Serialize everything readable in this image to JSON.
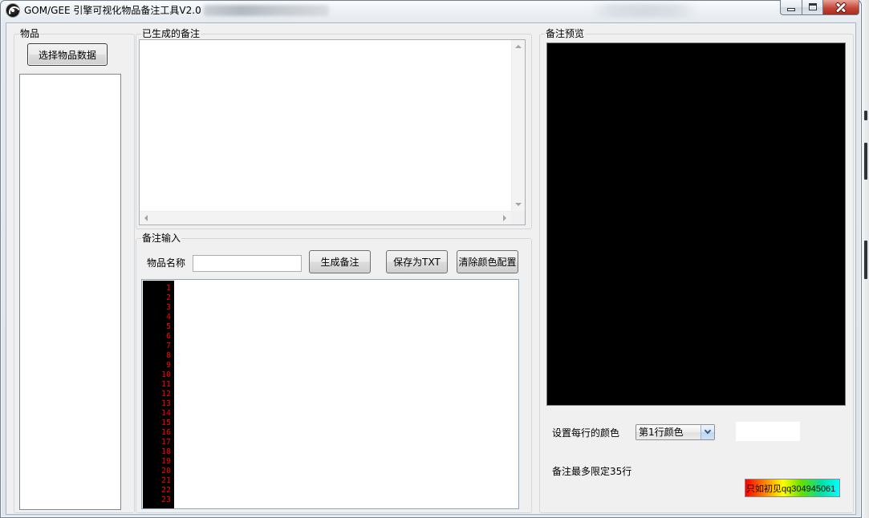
{
  "window": {
    "title": "GOM/GEE 引擎可视化物品备注工具V2.0"
  },
  "items_group": {
    "title": "物品",
    "select_button_label": "选择物品数据",
    "items": []
  },
  "generated_group": {
    "title": "已生成的备注",
    "text": ""
  },
  "input_group": {
    "title": "备注输入",
    "item_name_label": "物品名称",
    "item_name_value": "",
    "generate_button_label": "生成备注",
    "save_button_label": "保存为TXT",
    "clear_button_label": "清除颜色配置",
    "line_numbers": [
      "1",
      "2",
      "3",
      "4",
      "5",
      "6",
      "7",
      "8",
      "9",
      "10",
      "11",
      "12",
      "13",
      "14",
      "15",
      "16",
      "17",
      "18",
      "19",
      "20",
      "21",
      "22",
      "23"
    ],
    "editor_text": ""
  },
  "preview_group": {
    "title": "备注预览",
    "row_color_label": "设置每行的颜色",
    "row_color_selected": "第1行颜色",
    "line_limit_text": "备注最多限定35行",
    "credit_text": "只如初见qq304945061"
  },
  "icons": {
    "app": "app-logo-icon",
    "minimize": "minimize-icon",
    "maximize": "maximize-icon",
    "close": "close-icon",
    "combo_dropdown": "chevron-down-icon",
    "scroll_arrows": [
      "scroll-up-arrow-icon",
      "scroll-down-arrow-icon",
      "scroll-left-arrow-icon",
      "scroll-right-arrow-icon"
    ]
  },
  "colors": {
    "window_background": "#f0f0f0",
    "preview_background": "#000000",
    "line_number_gutter": "#000000",
    "line_number_text": "#ff0000",
    "row_color_swatch": "#ffffff",
    "close_button": "#c7463a",
    "credit_gradient": [
      "#ff0000",
      "#ff8000",
      "#ffff00",
      "#60e000",
      "#00e0a0",
      "#00ffff"
    ]
  }
}
